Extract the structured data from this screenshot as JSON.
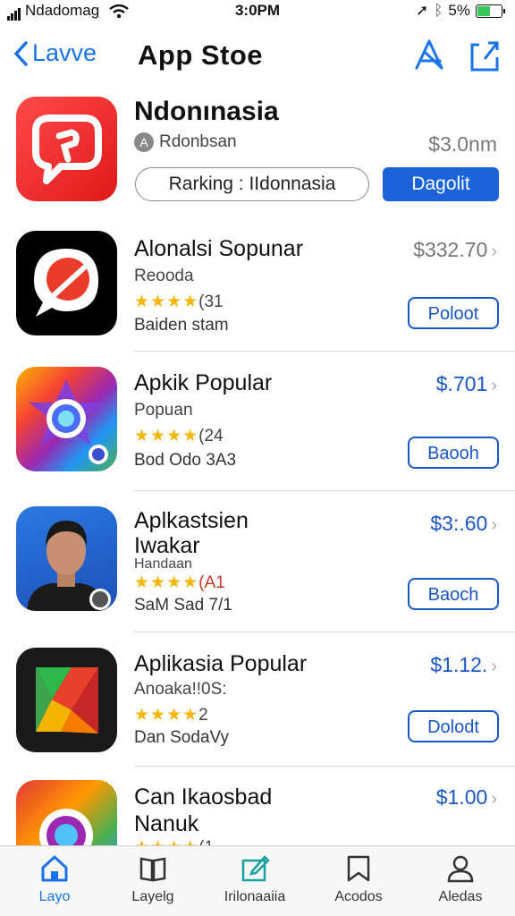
{
  "status": {
    "carrier": "Ndadomag",
    "time": "3:0PM",
    "battery": "5%",
    "battery_level": 0.5
  },
  "nav": {
    "back_label": "Lavve",
    "title": "App Stoe"
  },
  "featured": {
    "name": "Ndonınasia",
    "developer": "Rdonbsan",
    "price": "$3.0nm",
    "ranking": "Rarking : IIdonnasia",
    "action": "Dagolit"
  },
  "apps": [
    {
      "name": "Alonalsi Sopunar",
      "subtitle": "Reooda",
      "rating_count": "(31",
      "meta": "Baiden stam",
      "price": "$332.70",
      "action": "Poloot"
    },
    {
      "name": "Apkik Popular",
      "subtitle": "Popuan",
      "rating_count": "(24",
      "meta": "Bod Odo 3A3",
      "price": "$.701",
      "action": "Baooh"
    },
    {
      "name": "Aplkastsien",
      "name2": "Iwakar",
      "subtitle": "Handaan",
      "rating_count": "(A1",
      "meta": "SaM Sad 7/1",
      "price": "$3:.60",
      "action": "Baoch"
    },
    {
      "name": "Aplikasia Popular",
      "subtitle": "Anoaka!!0S:",
      "rating_count": "2",
      "meta": "Dan SodaVy",
      "price": "$1.12.",
      "action": "Dolodt"
    },
    {
      "name": "Can Ikaosbad",
      "name2": "Nanuk",
      "subtitle": "",
      "rating_count": "(1",
      "meta": "",
      "price": "$1.00",
      "action": ""
    }
  ],
  "tabs": [
    {
      "label": "Layo",
      "icon": "house-icon"
    },
    {
      "label": "Layelg",
      "icon": "book-icon"
    },
    {
      "label": "Irilonaaiia",
      "icon": "edit-icon"
    },
    {
      "label": "Acodos",
      "icon": "bookmark-icon"
    },
    {
      "label": "Aledas",
      "icon": "person-icon"
    }
  ],
  "colors": {
    "accent": "#1a73e8",
    "button_blue": "#1a56c7",
    "star": "#f5b60a"
  }
}
